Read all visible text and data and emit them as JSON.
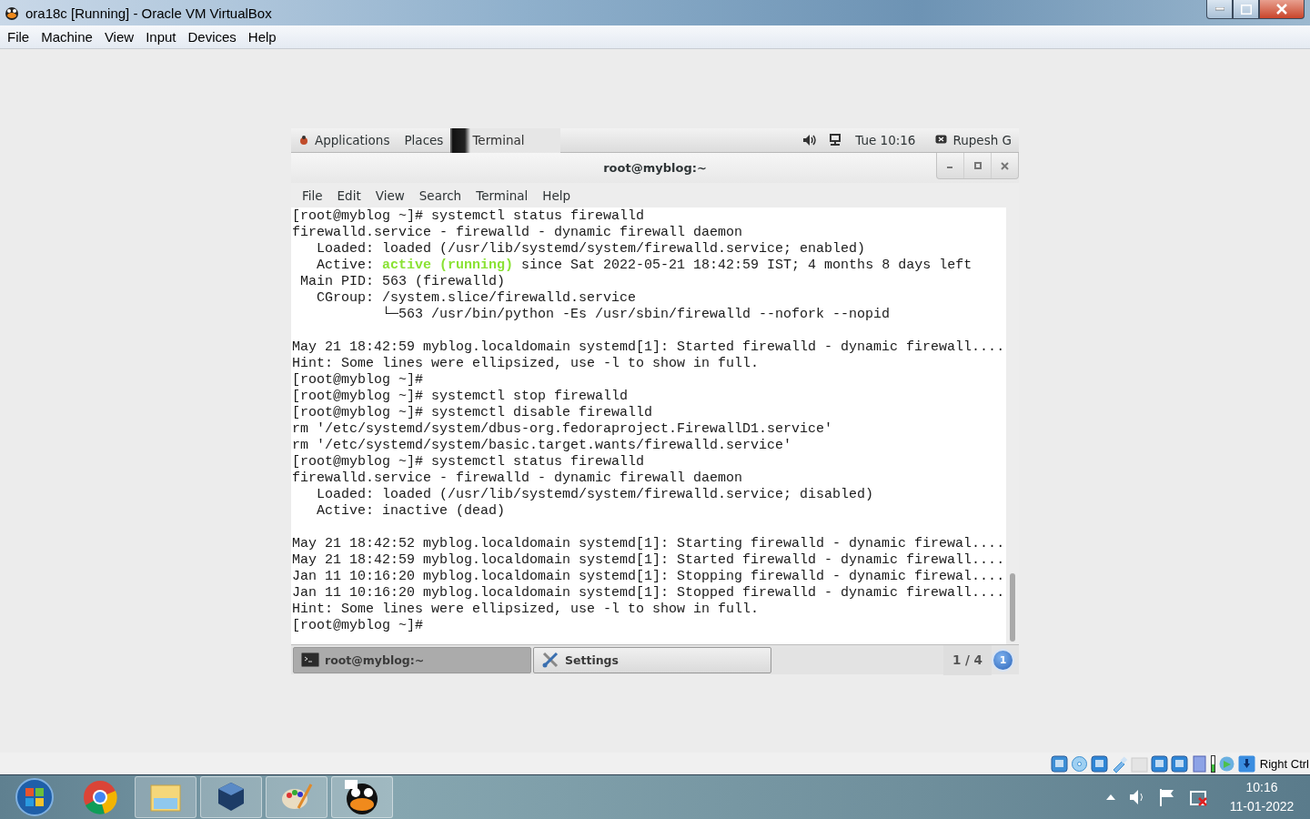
{
  "window": {
    "title": "ora18c [Running] - Oracle VM VirtualBox"
  },
  "menu": [
    "File",
    "Machine",
    "View",
    "Input",
    "Devices",
    "Help"
  ],
  "guest": {
    "top_bar": {
      "applications": "Applications",
      "places": "Places",
      "task": "Terminal",
      "clock": "Tue 10:16",
      "user": "Rupesh G"
    },
    "terminal": {
      "title": "root@myblog:~",
      "menu": [
        "File",
        "Edit",
        "View",
        "Search",
        "Terminal",
        "Help"
      ],
      "lines": [
        {
          "kind": "plain",
          "text": "[root@myblog ~]# systemctl status firewalld"
        },
        {
          "kind": "plain",
          "text": "firewalld.service - firewalld - dynamic firewall daemon"
        },
        {
          "kind": "plain",
          "text": "   Loaded: loaded (/usr/lib/systemd/system/firewalld.service; enabled)"
        },
        {
          "kind": "status",
          "before": "   Active: ",
          "highlight": "active (running)",
          "after": " since Sat 2022-05-21 18:42:59 IST; 4 months 8 days left"
        },
        {
          "kind": "plain",
          "text": " Main PID: 563 (firewalld)"
        },
        {
          "kind": "plain",
          "text": "   CGroup: /system.slice/firewalld.service"
        },
        {
          "kind": "plain",
          "text": "           └─563 /usr/bin/python -Es /usr/sbin/firewalld --nofork --nopid"
        },
        {
          "kind": "blank"
        },
        {
          "kind": "plain",
          "text": "May 21 18:42:59 myblog.localdomain systemd[1]: Started firewalld - dynamic firewall...."
        },
        {
          "kind": "plain",
          "text": "Hint: Some lines were ellipsized, use -l to show in full."
        },
        {
          "kind": "plain",
          "text": "[root@myblog ~]#"
        },
        {
          "kind": "plain",
          "text": "[root@myblog ~]# systemctl stop firewalld"
        },
        {
          "kind": "plain",
          "text": "[root@myblog ~]# systemctl disable firewalld"
        },
        {
          "kind": "plain",
          "text": "rm '/etc/systemd/system/dbus-org.fedoraproject.FirewallD1.service'"
        },
        {
          "kind": "plain",
          "text": "rm '/etc/systemd/system/basic.target.wants/firewalld.service'"
        },
        {
          "kind": "plain",
          "text": "[root@myblog ~]# systemctl status firewalld"
        },
        {
          "kind": "plain",
          "text": "firewalld.service - firewalld - dynamic firewall daemon"
        },
        {
          "kind": "plain",
          "text": "   Loaded: loaded (/usr/lib/systemd/system/firewalld.service; disabled)"
        },
        {
          "kind": "plain",
          "text": "   Active: inactive (dead)"
        },
        {
          "kind": "blank"
        },
        {
          "kind": "plain",
          "text": "May 21 18:42:52 myblog.localdomain systemd[1]: Starting firewalld - dynamic firewal...."
        },
        {
          "kind": "plain",
          "text": "May 21 18:42:59 myblog.localdomain systemd[1]: Started firewalld - dynamic firewall...."
        },
        {
          "kind": "plain",
          "text": "Jan 11 10:16:20 myblog.localdomain systemd[1]: Stopping firewalld - dynamic firewal...."
        },
        {
          "kind": "plain",
          "text": "Jan 11 10:16:20 myblog.localdomain systemd[1]: Stopped firewalld - dynamic firewall...."
        },
        {
          "kind": "plain",
          "text": "Hint: Some lines were ellipsized, use -l to show in full."
        },
        {
          "kind": "plain",
          "text": "[root@myblog ~]#"
        }
      ]
    },
    "window_list": [
      {
        "label": "root@myblog:~",
        "selected": true,
        "kind": "terminal"
      },
      {
        "label": "Settings",
        "selected": false,
        "kind": "settings"
      }
    ],
    "workspace": "1 / 4",
    "notifications": "1"
  },
  "status_bar": {
    "host_key": "Right Ctrl"
  },
  "taskbar": {
    "clock": "10:16",
    "date": "11-01-2022"
  }
}
